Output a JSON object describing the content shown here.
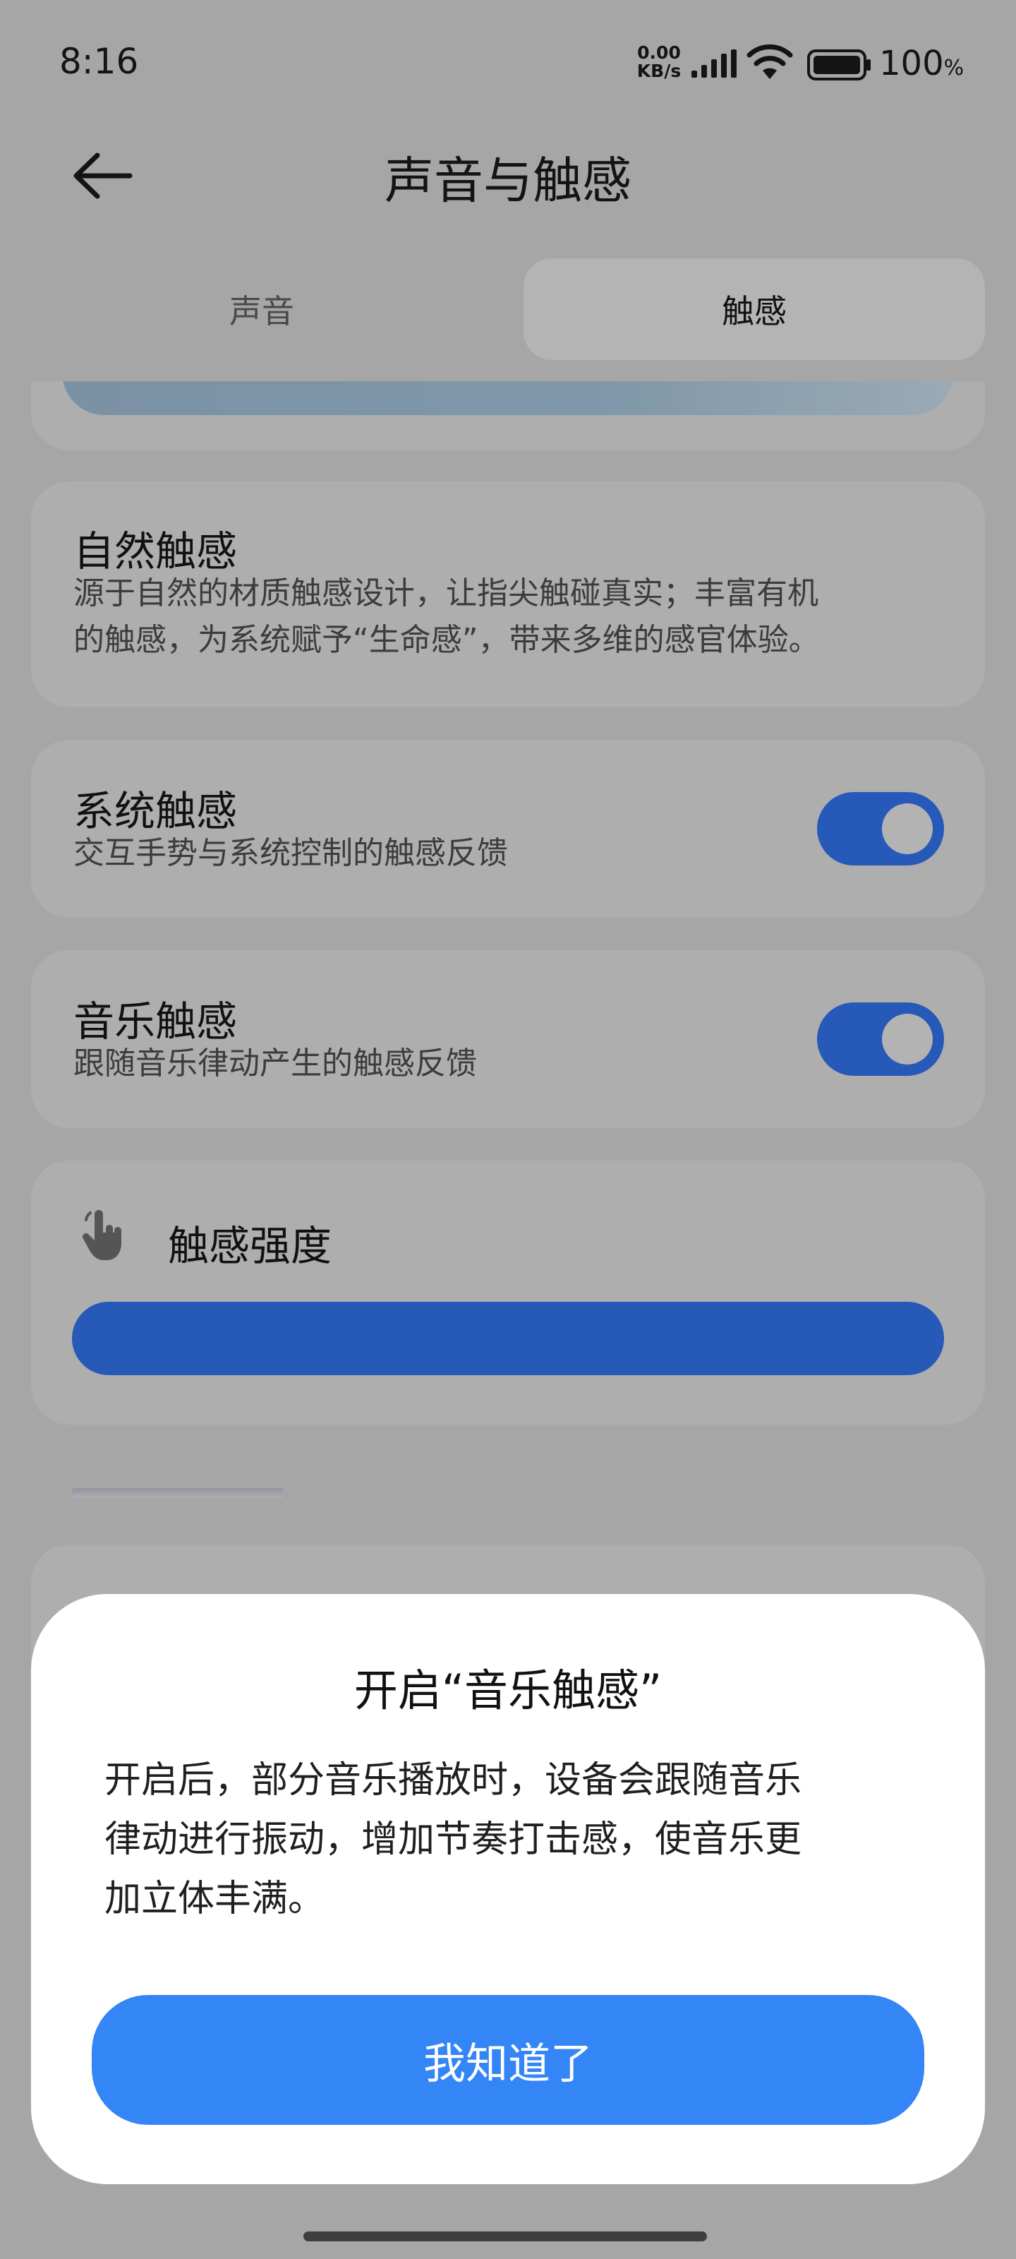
{
  "status_bar": {
    "time": "8:16",
    "net_speed_value": "0.00",
    "net_speed_unit": "KB/s",
    "battery_level": "100",
    "battery_unit": "%",
    "signal_icon": "signal-icon",
    "wifi_icon": "wifi-icon",
    "battery_icon": "battery-icon"
  },
  "header": {
    "title": "声音与触感",
    "back_icon": "back-arrow-icon"
  },
  "tabs": [
    {
      "label": "声音",
      "selected": false
    },
    {
      "label": "触感",
      "selected": true
    }
  ],
  "cards": {
    "natural_haptics": {
      "title": "自然触感",
      "description_line1": "源于自然的材质触感设计，让指尖触碰真实；丰富有机",
      "description_line2": "的触感，为系统赋予“生命感”，带来多维的感官体验。"
    },
    "system_haptics": {
      "title": "系统触感",
      "description": "交互手势与系统控制的触感反馈",
      "enabled": true
    },
    "music_haptics": {
      "title": "音乐触感",
      "description": "跟随音乐律动产生的触感反馈",
      "enabled": true
    },
    "haptic_intensity": {
      "title": "触感强度",
      "icon": "hand-tap-icon",
      "level": 1.0
    }
  },
  "dialog": {
    "title": "开启“音乐触感”",
    "body_line1": "开启后，部分音乐播放时，设备会跟随音乐",
    "body_line2": "律动进行振动，增加节奏打击感，使音乐更",
    "body_line3": "加立体丰满。",
    "confirm_label": "我知道了"
  },
  "colors": {
    "accent": "#3485f6",
    "toggle_on": "#2659b8",
    "scrim_background": "#a6a6a6"
  }
}
